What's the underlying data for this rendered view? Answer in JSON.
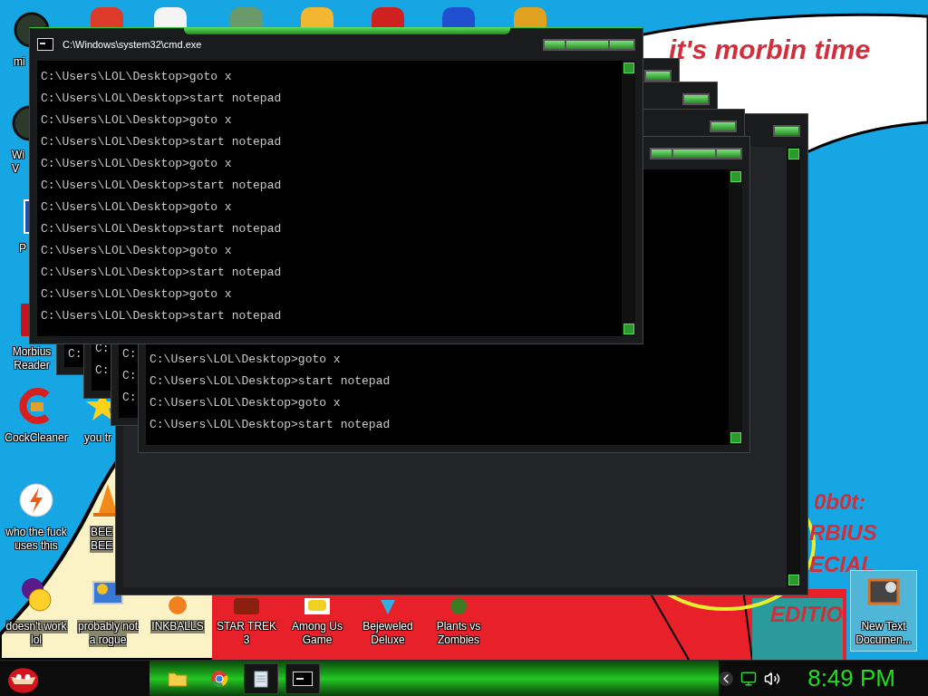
{
  "wallpaper_texts": [
    "it's morbin time",
    "0b0t:",
    "RBIUS",
    "ECIAL",
    "EDITIO"
  ],
  "desktop_icons": [
    {
      "lines": [
        "mi"
      ],
      "selected": false
    },
    {
      "lines": [
        "Wi",
        "V"
      ],
      "selected": false
    },
    {
      "lines": [
        "P"
      ],
      "selected": false
    },
    {
      "lines": [
        "Morbius",
        "Reader"
      ],
      "selected": false
    },
    {
      "lines": [
        "CockCleaner"
      ],
      "selected": false
    },
    {
      "lines": [
        "who the fuck",
        "uses this"
      ],
      "selected": false
    },
    {
      "lines": [
        "doesn't work",
        "lol"
      ],
      "selected": false
    },
    {
      "lines": [
        "you tr"
      ],
      "selected": false
    },
    {
      "lines": [
        "BEE",
        "BEE"
      ],
      "selected": false
    },
    {
      "lines": [
        "probably not",
        "a rogue"
      ],
      "selected": false
    },
    {
      "lines": [
        "INKBALLS"
      ],
      "selected": false
    },
    {
      "lines": [
        "STAR TREK",
        "3"
      ],
      "selected": false
    },
    {
      "lines": [
        "Among Us",
        "Game"
      ],
      "selected": false
    },
    {
      "lines": [
        "Bejeweled",
        "Deluxe"
      ],
      "selected": false
    },
    {
      "lines": [
        "Plants vs",
        "Zombies"
      ],
      "selected": false
    },
    {
      "lines": [
        "New Text",
        "Documen..."
      ],
      "selected": true
    }
  ],
  "windows": [
    {
      "active": false
    },
    {
      "active": false,
      "lines": [
        "C:"
      ]
    },
    {
      "active": false,
      "lines": [
        "C:",
        "C:"
      ]
    },
    {
      "active": false,
      "lines": [
        "C:",
        "C:",
        "C:"
      ]
    },
    {
      "active": false,
      "lines": [
        "C:\\Users\\LOL\\Desktop>goto x",
        "C:\\Users\\LOL\\Desktop>start notepad",
        "C:\\Users\\LOL\\Desktop>goto x",
        "C:\\Users\\LOL\\Desktop>start notepad"
      ]
    },
    {
      "active": true,
      "title": "C:\\Windows\\system32\\cmd.exe",
      "lines": [
        "C:\\Users\\LOL\\Desktop>goto x",
        "C:\\Users\\LOL\\Desktop>start notepad",
        "C:\\Users\\LOL\\Desktop>goto x",
        "C:\\Users\\LOL\\Desktop>start notepad",
        "C:\\Users\\LOL\\Desktop>goto x",
        "C:\\Users\\LOL\\Desktop>start notepad",
        "C:\\Users\\LOL\\Desktop>goto x",
        "C:\\Users\\LOL\\Desktop>start notepad",
        "C:\\Users\\LOL\\Desktop>goto x",
        "C:\\Users\\LOL\\Desktop>start notepad",
        "C:\\Users\\LOL\\Desktop>goto x",
        "C:\\Users\\LOL\\Desktop>start notepad"
      ]
    }
  ],
  "taskbar": {
    "buttons": [
      {
        "kind": "folder",
        "open": false
      },
      {
        "kind": "browser",
        "open": false
      },
      {
        "kind": "notepad",
        "open": true
      },
      {
        "kind": "console",
        "open": true
      }
    ],
    "clock": "8:49 PM"
  }
}
